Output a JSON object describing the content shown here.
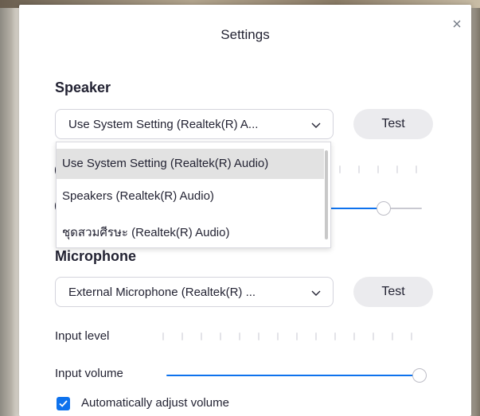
{
  "dialog": {
    "title": "Settings",
    "close_icon": "close-icon"
  },
  "speaker": {
    "heading": "Speaker",
    "selected": "Use System Setting (Realtek(R) A...",
    "test_label": "Test",
    "dropdown_options": [
      "Use System Setting (Realtek(R) Audio)",
      "Speakers (Realtek(R) Audio)",
      "ชุดสวมศีรษะ (Realtek(R) Audio)"
    ],
    "highlighted_option_index": 0,
    "output_volume_level": 0.84
  },
  "microphone": {
    "heading": "Microphone",
    "selected": "External Microphone (Realtek(R) ...",
    "test_label": "Test",
    "input_level_label": "Input level",
    "input_volume_label": "Input volume",
    "input_volume_level": 1.0
  },
  "auto_adjust": {
    "label": "Automatically adjust volume",
    "checked": true
  },
  "colors": {
    "accent": "#0e72ed",
    "text": "#232333"
  }
}
